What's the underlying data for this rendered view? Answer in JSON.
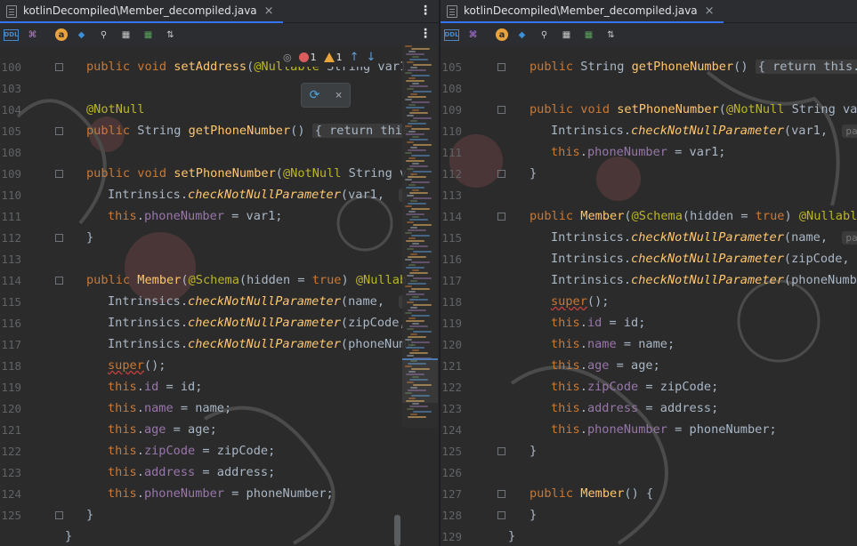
{
  "left": {
    "tab": {
      "title": "kotlinDecompiled\\Member_decompiled.java",
      "close": "×",
      "icon": "java-file-icon"
    },
    "kebab": "⋮",
    "toolbar": [
      {
        "name": "ddl-icon",
        "glyph": "DDL",
        "color": "#4a88c7"
      },
      {
        "name": "structure-icon",
        "glyph": "⌘",
        "color": "#b57bd8"
      },
      {
        "name": "annotation-icon",
        "glyph": "a",
        "color": "#e8a33d"
      },
      {
        "name": "entity-icon",
        "glyph": "◆",
        "color": "#3d8fd8"
      },
      {
        "name": "key-icon",
        "glyph": "⚲",
        "color": "#c9c9c9"
      },
      {
        "name": "table-icon",
        "glyph": "▦",
        "color": "#c9c9c9"
      },
      {
        "name": "generate-icon",
        "glyph": "▦",
        "color": "#5aa35a"
      },
      {
        "name": "sort-icon",
        "glyph": "⇅",
        "color": "#c9c9c9"
      }
    ],
    "inspection": {
      "errors": "1",
      "warnings": "1",
      "up": "↑",
      "down": "↓",
      "eye": "◎"
    },
    "popup_close": "×",
    "lines": [
      {
        "num": "100",
        "tokens": [
          {
            "c": "kw",
            "t": "public "
          },
          {
            "c": "kw",
            "t": "void "
          },
          {
            "c": "fn",
            "t": "setAddress"
          },
          {
            "c": "typ",
            "t": "("
          },
          {
            "c": "ann",
            "t": "@Nullable "
          },
          {
            "c": "typ",
            "t": "String var1"
          }
        ],
        "indent": 0,
        "fold": true
      },
      {
        "num": "103",
        "tokens": [],
        "indent": 0
      },
      {
        "num": "104",
        "tokens": [
          {
            "c": "ann",
            "t": "@NotNull"
          }
        ],
        "indent": 0
      },
      {
        "num": "105",
        "tokens": [
          {
            "c": "kw",
            "t": "public "
          },
          {
            "c": "typ",
            "t": "String "
          },
          {
            "c": "fn",
            "t": "getPhoneNumber"
          },
          {
            "c": "typ",
            "t": "() "
          },
          {
            "c": "foldbox",
            "t": "{ return this"
          }
        ],
        "indent": 0,
        "fold": true
      },
      {
        "num": "108",
        "tokens": [],
        "indent": 0
      },
      {
        "num": "109",
        "tokens": [
          {
            "c": "kw",
            "t": "public "
          },
          {
            "c": "kw",
            "t": "void "
          },
          {
            "c": "fn",
            "t": "setPhoneNumber"
          },
          {
            "c": "typ",
            "t": "("
          },
          {
            "c": "ann",
            "t": "@NotNull "
          },
          {
            "c": "typ",
            "t": "String va"
          }
        ],
        "indent": 0,
        "fold": true
      },
      {
        "num": "110",
        "tokens": [
          {
            "c": "typ",
            "t": "Intrinsics."
          },
          {
            "c": "mth",
            "t": "checkNotNullParameter"
          },
          {
            "c": "typ",
            "t": "(var1,  "
          },
          {
            "c": "hint",
            "t": "pa"
          }
        ],
        "indent": 1
      },
      {
        "num": "111",
        "tokens": [
          {
            "c": "kw",
            "t": "this"
          },
          {
            "c": "typ",
            "t": "."
          },
          {
            "c": "fld",
            "t": "phoneNumber"
          },
          {
            "c": "typ",
            "t": " = var1;"
          }
        ],
        "indent": 1
      },
      {
        "num": "112",
        "tokens": [
          {
            "c": "typ",
            "t": "}"
          }
        ],
        "indent": 0,
        "fold": true
      },
      {
        "num": "113",
        "tokens": [],
        "indent": 0
      },
      {
        "num": "114",
        "tokens": [
          {
            "c": "kw",
            "t": "public "
          },
          {
            "c": "fn",
            "t": "Member"
          },
          {
            "c": "typ",
            "t": "("
          },
          {
            "c": "ann",
            "t": "@Schema"
          },
          {
            "c": "typ",
            "t": "(hidden = "
          },
          {
            "c": "kw",
            "t": "true"
          },
          {
            "c": "typ",
            "t": ") "
          },
          {
            "c": "ann",
            "t": "@Nullab"
          }
        ],
        "indent": 0,
        "fold": true
      },
      {
        "num": "115",
        "tokens": [
          {
            "c": "typ",
            "t": "Intrinsics."
          },
          {
            "c": "mth",
            "t": "checkNotNullParameter"
          },
          {
            "c": "typ",
            "t": "(name,  "
          },
          {
            "c": "hint",
            "t": "pa"
          }
        ],
        "indent": 1
      },
      {
        "num": "116",
        "tokens": [
          {
            "c": "typ",
            "t": "Intrinsics."
          },
          {
            "c": "mth",
            "t": "checkNotNullParameter"
          },
          {
            "c": "typ",
            "t": "(zipCode,"
          }
        ],
        "indent": 1
      },
      {
        "num": "117",
        "tokens": [
          {
            "c": "typ",
            "t": "Intrinsics."
          },
          {
            "c": "mth",
            "t": "checkNotNullParameter"
          },
          {
            "c": "typ",
            "t": "(phoneNumb"
          }
        ],
        "indent": 1
      },
      {
        "num": "118",
        "tokens": [
          {
            "c": "super",
            "t": "super"
          },
          {
            "c": "typ",
            "t": "();"
          }
        ],
        "indent": 1
      },
      {
        "num": "119",
        "tokens": [
          {
            "c": "kw",
            "t": "this"
          },
          {
            "c": "typ",
            "t": "."
          },
          {
            "c": "fld",
            "t": "id"
          },
          {
            "c": "typ",
            "t": " = id;"
          }
        ],
        "indent": 1
      },
      {
        "num": "120",
        "tokens": [
          {
            "c": "kw",
            "t": "this"
          },
          {
            "c": "typ",
            "t": "."
          },
          {
            "c": "fld",
            "t": "name"
          },
          {
            "c": "typ",
            "t": " = name;"
          }
        ],
        "indent": 1
      },
      {
        "num": "121",
        "tokens": [
          {
            "c": "kw",
            "t": "this"
          },
          {
            "c": "typ",
            "t": "."
          },
          {
            "c": "fld",
            "t": "age"
          },
          {
            "c": "typ",
            "t": " = age;"
          }
        ],
        "indent": 1
      },
      {
        "num": "122",
        "tokens": [
          {
            "c": "kw",
            "t": "this"
          },
          {
            "c": "typ",
            "t": "."
          },
          {
            "c": "fld",
            "t": "zipCode"
          },
          {
            "c": "typ",
            "t": " = zipCode;"
          }
        ],
        "indent": 1
      },
      {
        "num": "123",
        "tokens": [
          {
            "c": "kw",
            "t": "this"
          },
          {
            "c": "typ",
            "t": "."
          },
          {
            "c": "fld",
            "t": "address"
          },
          {
            "c": "typ",
            "t": " = address;"
          }
        ],
        "indent": 1
      },
      {
        "num": "124",
        "tokens": [
          {
            "c": "kw",
            "t": "this"
          },
          {
            "c": "typ",
            "t": "."
          },
          {
            "c": "fld",
            "t": "phoneNumber"
          },
          {
            "c": "typ",
            "t": " = phoneNumber;"
          }
        ],
        "indent": 1
      },
      {
        "num": "125",
        "tokens": [
          {
            "c": "typ",
            "t": "}"
          }
        ],
        "indent": 0,
        "fold": true
      },
      {
        "num": "",
        "tokens": [
          {
            "c": "typ",
            "t": "}"
          }
        ],
        "indent": -1
      }
    ]
  },
  "right": {
    "tab": {
      "title": "kotlinDecompiled\\Member_decompiled.java",
      "close": "×",
      "icon": "java-file-icon"
    },
    "toolbar": [
      {
        "name": "ddl-icon",
        "glyph": "DDL",
        "color": "#4a88c7"
      },
      {
        "name": "structure-icon",
        "glyph": "⌘",
        "color": "#b57bd8"
      },
      {
        "name": "annotation-icon",
        "glyph": "a",
        "color": "#e8a33d"
      },
      {
        "name": "entity-icon",
        "glyph": "◆",
        "color": "#3d8fd8"
      },
      {
        "name": "key-icon",
        "glyph": "⚲",
        "color": "#c9c9c9"
      },
      {
        "name": "table-icon",
        "glyph": "▦",
        "color": "#c9c9c9"
      },
      {
        "name": "generate-icon",
        "glyph": "▦",
        "color": "#5aa35a"
      },
      {
        "name": "sort-icon",
        "glyph": "⇅",
        "color": "#c9c9c9"
      }
    ],
    "lines": [
      {
        "num": "105",
        "tokens": [
          {
            "c": "kw",
            "t": "public "
          },
          {
            "c": "typ",
            "t": "String "
          },
          {
            "c": "fn",
            "t": "getPhoneNumber"
          },
          {
            "c": "typ",
            "t": "() "
          },
          {
            "c": "foldbox",
            "t": "{ return this.p"
          }
        ],
        "indent": 0,
        "fold": true
      },
      {
        "num": "108",
        "tokens": [],
        "indent": 0
      },
      {
        "num": "109",
        "tokens": [
          {
            "c": "kw",
            "t": "public "
          },
          {
            "c": "kw",
            "t": "void "
          },
          {
            "c": "fn",
            "t": "setPhoneNumber"
          },
          {
            "c": "typ",
            "t": "("
          },
          {
            "c": "ann",
            "t": "@NotNull "
          },
          {
            "c": "typ",
            "t": "String var"
          }
        ],
        "indent": 0,
        "fold": true
      },
      {
        "num": "110",
        "tokens": [
          {
            "c": "typ",
            "t": "Intrinsics."
          },
          {
            "c": "mth",
            "t": "checkNotNullParameter"
          },
          {
            "c": "typ",
            "t": "(var1,  "
          },
          {
            "c": "hint",
            "t": "para"
          }
        ],
        "indent": 1
      },
      {
        "num": "111",
        "tokens": [
          {
            "c": "kw",
            "t": "this"
          },
          {
            "c": "typ",
            "t": "."
          },
          {
            "c": "fld",
            "t": "phoneNumber"
          },
          {
            "c": "typ",
            "t": " = var1;"
          }
        ],
        "indent": 1
      },
      {
        "num": "112",
        "tokens": [
          {
            "c": "typ",
            "t": "}"
          }
        ],
        "indent": 0,
        "fold": true
      },
      {
        "num": "113",
        "tokens": [],
        "indent": 0
      },
      {
        "num": "114",
        "tokens": [
          {
            "c": "kw",
            "t": "public "
          },
          {
            "c": "fn",
            "t": "Member"
          },
          {
            "c": "typ",
            "t": "("
          },
          {
            "c": "ann",
            "t": "@Schema"
          },
          {
            "c": "typ",
            "t": "(hidden = "
          },
          {
            "c": "kw",
            "t": "true"
          },
          {
            "c": "typ",
            "t": ") "
          },
          {
            "c": "ann",
            "t": "@Nullable"
          }
        ],
        "indent": 0,
        "fold": true
      },
      {
        "num": "115",
        "tokens": [
          {
            "c": "typ",
            "t": "Intrinsics."
          },
          {
            "c": "mth",
            "t": "checkNotNullParameter"
          },
          {
            "c": "typ",
            "t": "(name,  "
          },
          {
            "c": "hint",
            "t": "para"
          }
        ],
        "indent": 1
      },
      {
        "num": "116",
        "tokens": [
          {
            "c": "typ",
            "t": "Intrinsics."
          },
          {
            "c": "mth",
            "t": "checkNotNullParameter"
          },
          {
            "c": "typ",
            "t": "(zipCode,"
          }
        ],
        "indent": 1
      },
      {
        "num": "117",
        "tokens": [
          {
            "c": "typ",
            "t": "Intrinsics."
          },
          {
            "c": "mth",
            "t": "checkNotNullParameter"
          },
          {
            "c": "typ",
            "t": "(phoneNumbe"
          }
        ],
        "indent": 1
      },
      {
        "num": "118",
        "tokens": [
          {
            "c": "super",
            "t": "super"
          },
          {
            "c": "typ",
            "t": "();"
          }
        ],
        "indent": 1
      },
      {
        "num": "119",
        "tokens": [
          {
            "c": "kw",
            "t": "this"
          },
          {
            "c": "typ",
            "t": "."
          },
          {
            "c": "fld",
            "t": "id"
          },
          {
            "c": "typ",
            "t": " = id;"
          }
        ],
        "indent": 1
      },
      {
        "num": "120",
        "tokens": [
          {
            "c": "kw",
            "t": "this"
          },
          {
            "c": "typ",
            "t": "."
          },
          {
            "c": "fld",
            "t": "name"
          },
          {
            "c": "typ",
            "t": " = name;"
          }
        ],
        "indent": 1
      },
      {
        "num": "121",
        "tokens": [
          {
            "c": "kw",
            "t": "this"
          },
          {
            "c": "typ",
            "t": "."
          },
          {
            "c": "fld",
            "t": "age"
          },
          {
            "c": "typ",
            "t": " = age;"
          }
        ],
        "indent": 1
      },
      {
        "num": "122",
        "tokens": [
          {
            "c": "kw",
            "t": "this"
          },
          {
            "c": "typ",
            "t": "."
          },
          {
            "c": "fld",
            "t": "zipCode"
          },
          {
            "c": "typ",
            "t": " = zipCode;"
          }
        ],
        "indent": 1
      },
      {
        "num": "123",
        "tokens": [
          {
            "c": "kw",
            "t": "this"
          },
          {
            "c": "typ",
            "t": "."
          },
          {
            "c": "fld",
            "t": "address"
          },
          {
            "c": "typ",
            "t": " = address;"
          }
        ],
        "indent": 1
      },
      {
        "num": "124",
        "tokens": [
          {
            "c": "kw",
            "t": "this"
          },
          {
            "c": "typ",
            "t": "."
          },
          {
            "c": "fld",
            "t": "phoneNumber"
          },
          {
            "c": "typ",
            "t": " = phoneNumber;"
          }
        ],
        "indent": 1
      },
      {
        "num": "125",
        "tokens": [
          {
            "c": "typ",
            "t": "}"
          }
        ],
        "indent": 0,
        "fold": true
      },
      {
        "num": "126",
        "tokens": [],
        "indent": 0
      },
      {
        "num": "127",
        "tokens": [
          {
            "c": "kw",
            "t": "public "
          },
          {
            "c": "fn",
            "t": "Member"
          },
          {
            "c": "typ",
            "t": "() {"
          }
        ],
        "indent": 0,
        "fold": true
      },
      {
        "num": "128",
        "tokens": [
          {
            "c": "typ",
            "t": "}"
          }
        ],
        "indent": 0,
        "fold": true
      },
      {
        "num": "129",
        "tokens": [
          {
            "c": "typ",
            "t": "}"
          }
        ],
        "indent": -1
      }
    ]
  },
  "colors": {
    "editor_bg": "#2b2b2b",
    "keyword": "#cc7832",
    "function": "#ffc66d",
    "annotation": "#bbb529",
    "field": "#9876aa",
    "text": "#a9b7c6",
    "line_number": "#606366",
    "accent": "#3574f0"
  }
}
